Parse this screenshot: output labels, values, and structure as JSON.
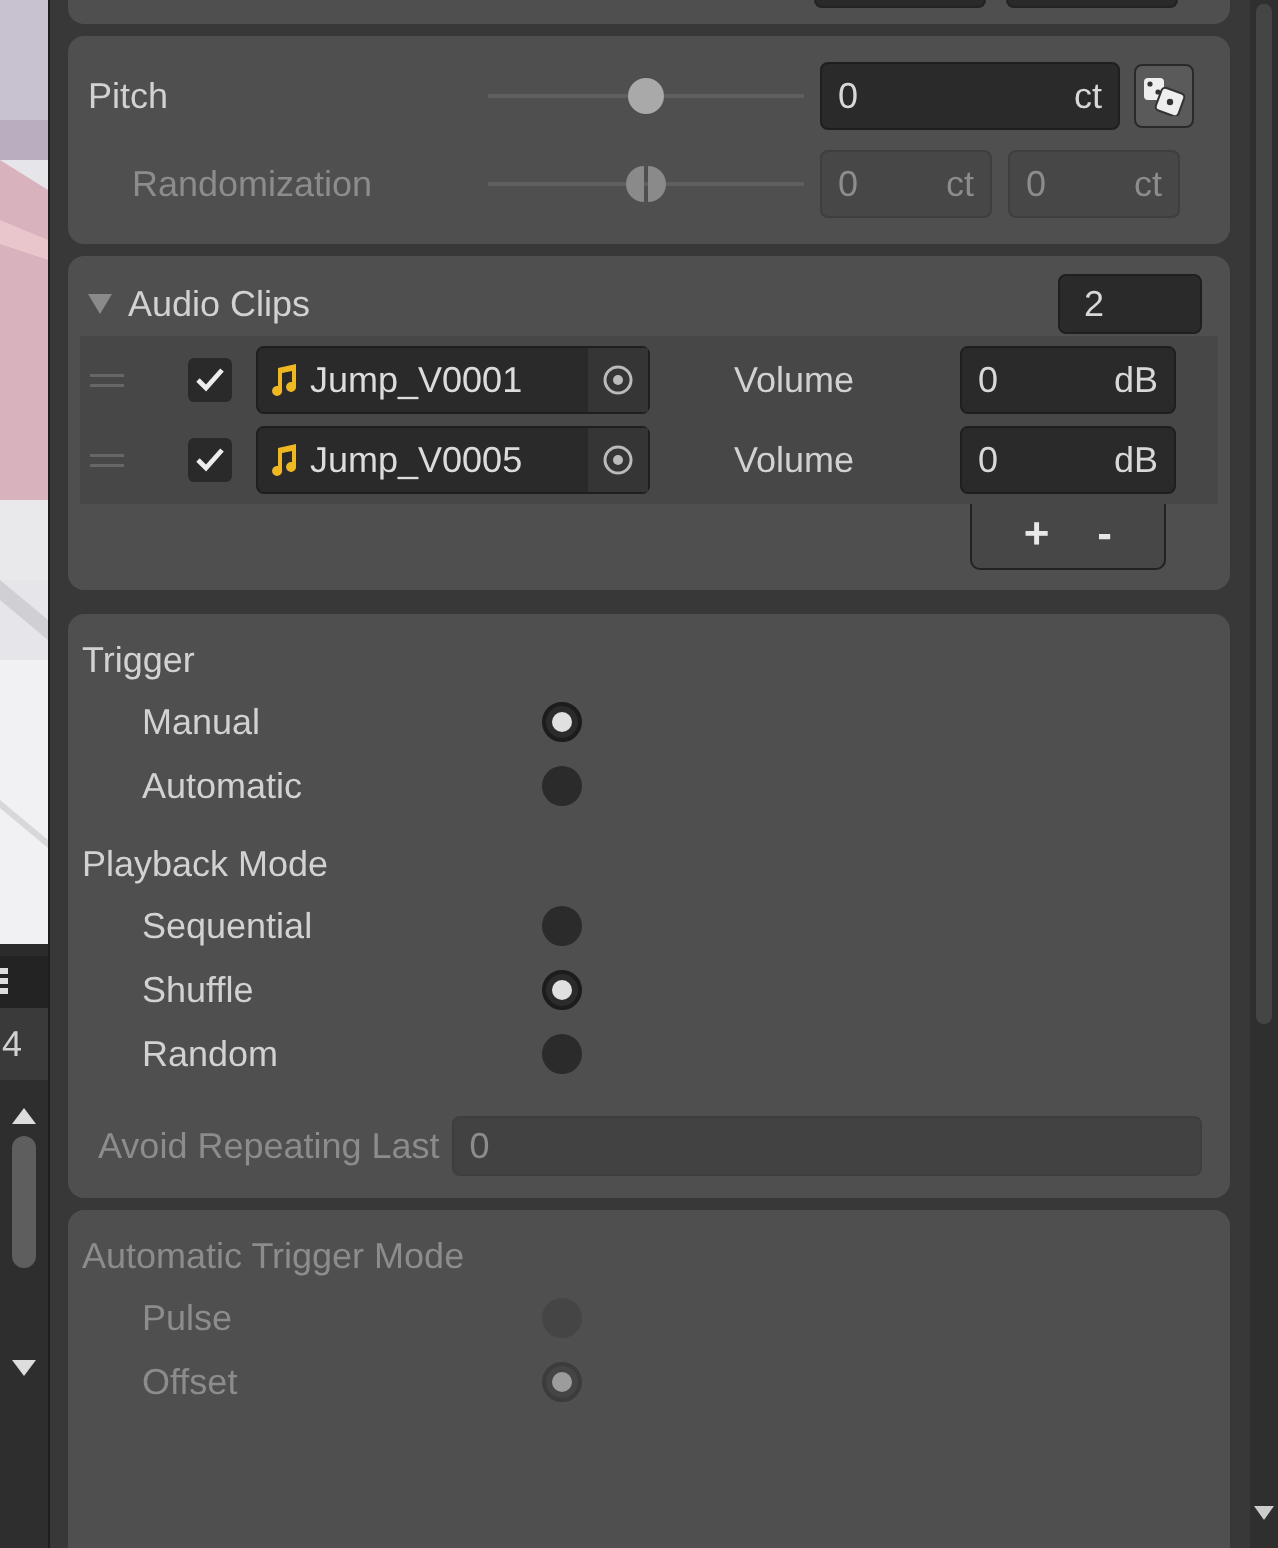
{
  "side_toolbar": {
    "count": "4"
  },
  "pitch": {
    "label": "Pitch",
    "level": 0.5,
    "value": "0",
    "unit": "ct",
    "randomization": {
      "label": "Randomization",
      "disabled": true,
      "level": 0.5,
      "min": {
        "value": "0",
        "unit": "ct"
      },
      "max": {
        "value": "0",
        "unit": "ct"
      }
    }
  },
  "audio_clips": {
    "title": "Audio Clips",
    "expanded": true,
    "count": "2",
    "add": "+",
    "remove": "-",
    "clips": [
      {
        "checked": true,
        "name": "Jump_V0001",
        "volume_label": "Volume",
        "volume": "0",
        "unit": "dB"
      },
      {
        "checked": true,
        "name": "Jump_V0005",
        "volume_label": "Volume",
        "volume": "0",
        "unit": "dB"
      }
    ]
  },
  "playback": {
    "groups": [
      {
        "title": "Trigger",
        "options": [
          {
            "label": "Manual",
            "selected": true
          },
          {
            "label": "Automatic",
            "selected": false
          }
        ]
      },
      {
        "title": "Playback Mode",
        "options": [
          {
            "label": "Sequential",
            "selected": false
          },
          {
            "label": "Shuffle",
            "selected": true
          },
          {
            "label": "Random",
            "selected": false
          }
        ]
      }
    ],
    "avoid_repeating": {
      "label": "Avoid Repeating Last",
      "value": "0",
      "disabled": true
    }
  },
  "automatic_trigger_mode": {
    "title": "Automatic Trigger Mode",
    "disabled": true,
    "options": [
      {
        "label": "Pulse",
        "selected": false
      },
      {
        "label": "Offset",
        "selected": true
      }
    ]
  }
}
